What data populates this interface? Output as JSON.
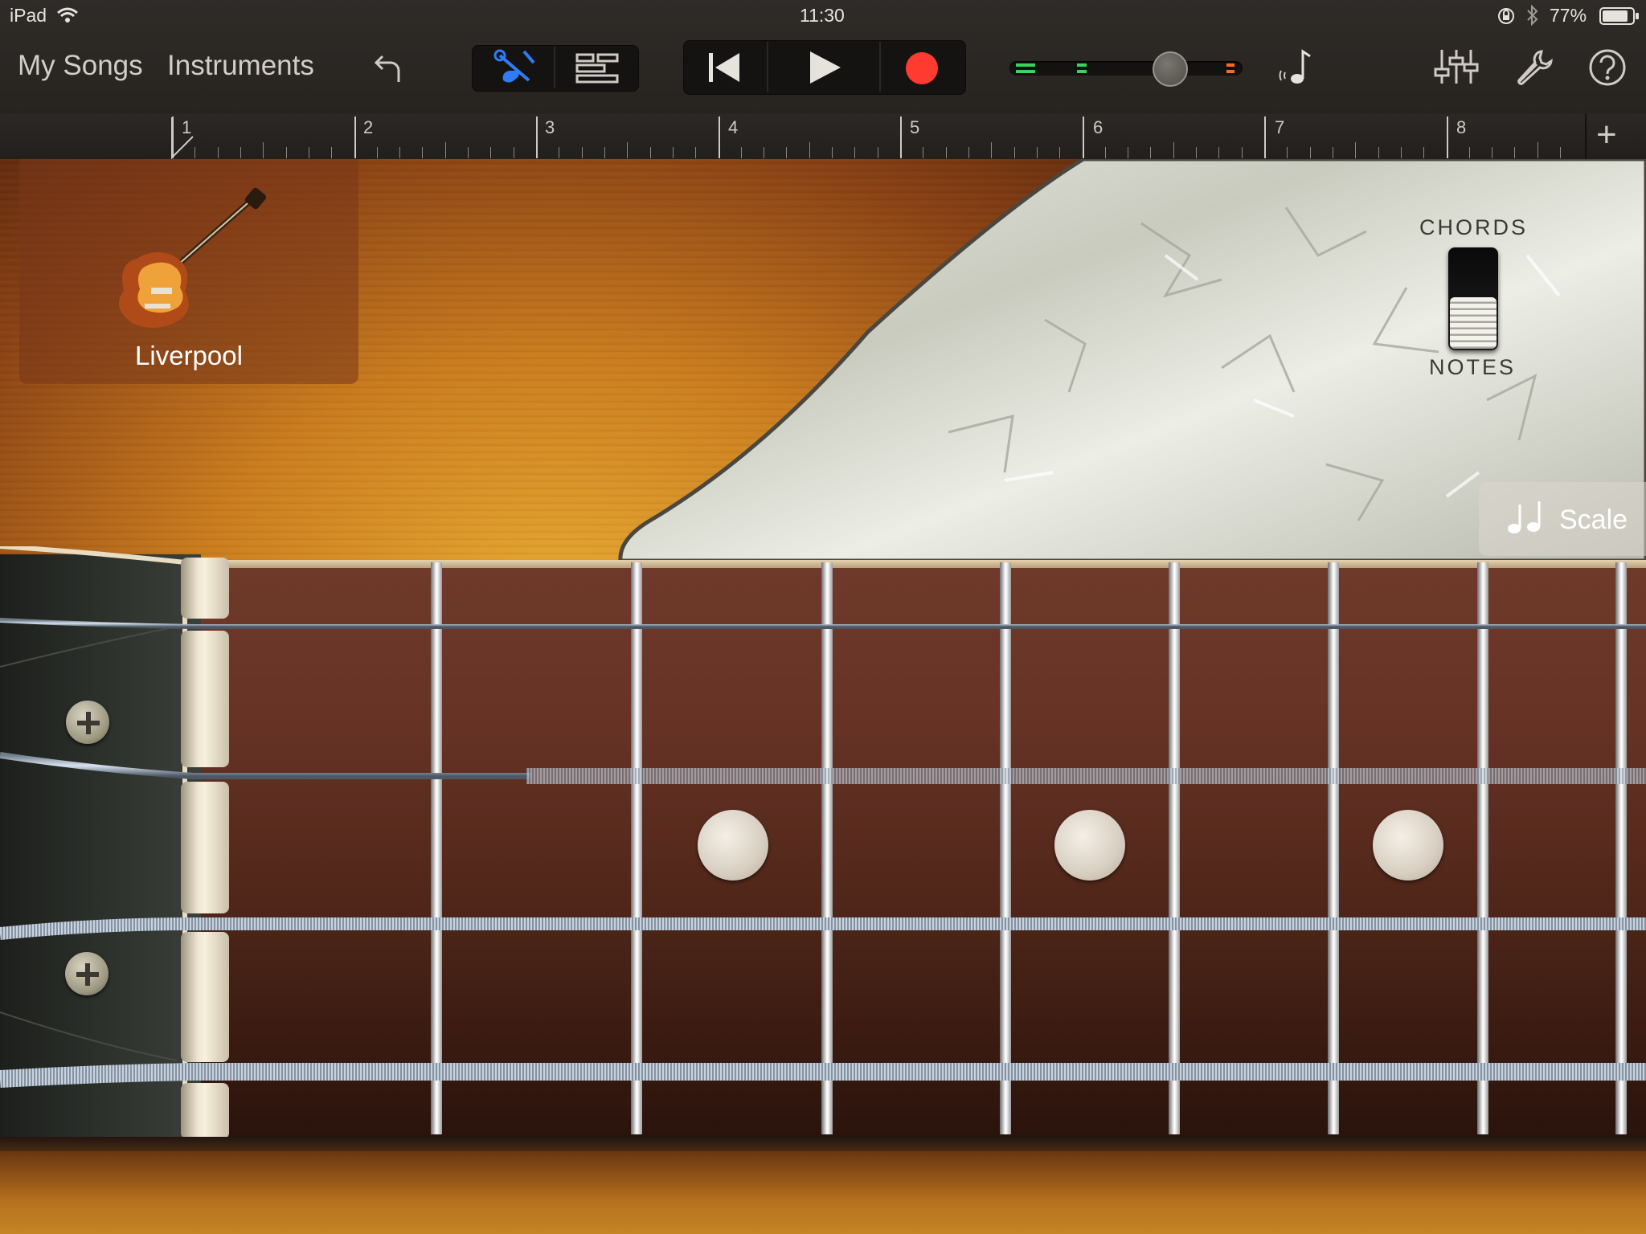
{
  "status_bar": {
    "device": "iPad",
    "time": "11:30",
    "battery": "77%"
  },
  "toolbar": {
    "my_songs": "My Songs",
    "instruments": "Instruments",
    "icons": [
      "undo-icon",
      "guitar-view-icon",
      "tracks-view-icon",
      "rewind-icon",
      "play-icon",
      "record-icon",
      "volume-slider",
      "metronome-icon",
      "mixer-icon",
      "settings-wrench-icon",
      "help-icon"
    ],
    "record_color": "#ff3b30",
    "accent_color": "#2f7cf6"
  },
  "ruler": {
    "bars": [
      "1",
      "2",
      "3",
      "4",
      "5",
      "6",
      "7",
      "8"
    ],
    "add_label": "+"
  },
  "instrument": {
    "name": "Liverpool"
  },
  "mode_switch": {
    "top_label": "CHORDS",
    "bottom_label": "NOTES",
    "selected": "NOTES"
  },
  "scale_button": {
    "label": "Scale"
  }
}
